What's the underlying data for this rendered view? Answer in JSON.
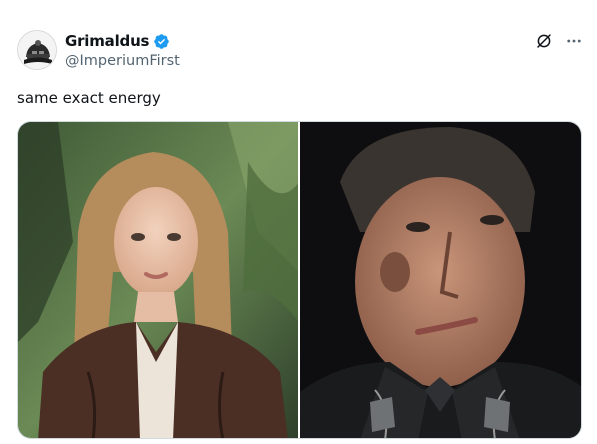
{
  "author": {
    "display_name": "Grimaldus",
    "handle": "@ImperiumFirst",
    "verified": true,
    "avatar_icon": "space-marine-helmet-avatar"
  },
  "actions": {
    "grok_icon": "grok-icon",
    "more_icon": "more-options-icon"
  },
  "tweet": {
    "text": "same exact energy"
  },
  "media": {
    "images": [
      {
        "description_icon": "photo-woman-leather-jacket"
      },
      {
        "description_icon": "photo-man-uniform"
      }
    ]
  },
  "colors": {
    "verified_blue": "#1d9bf0",
    "handle_gray": "#536471",
    "text": "#0f1419"
  }
}
